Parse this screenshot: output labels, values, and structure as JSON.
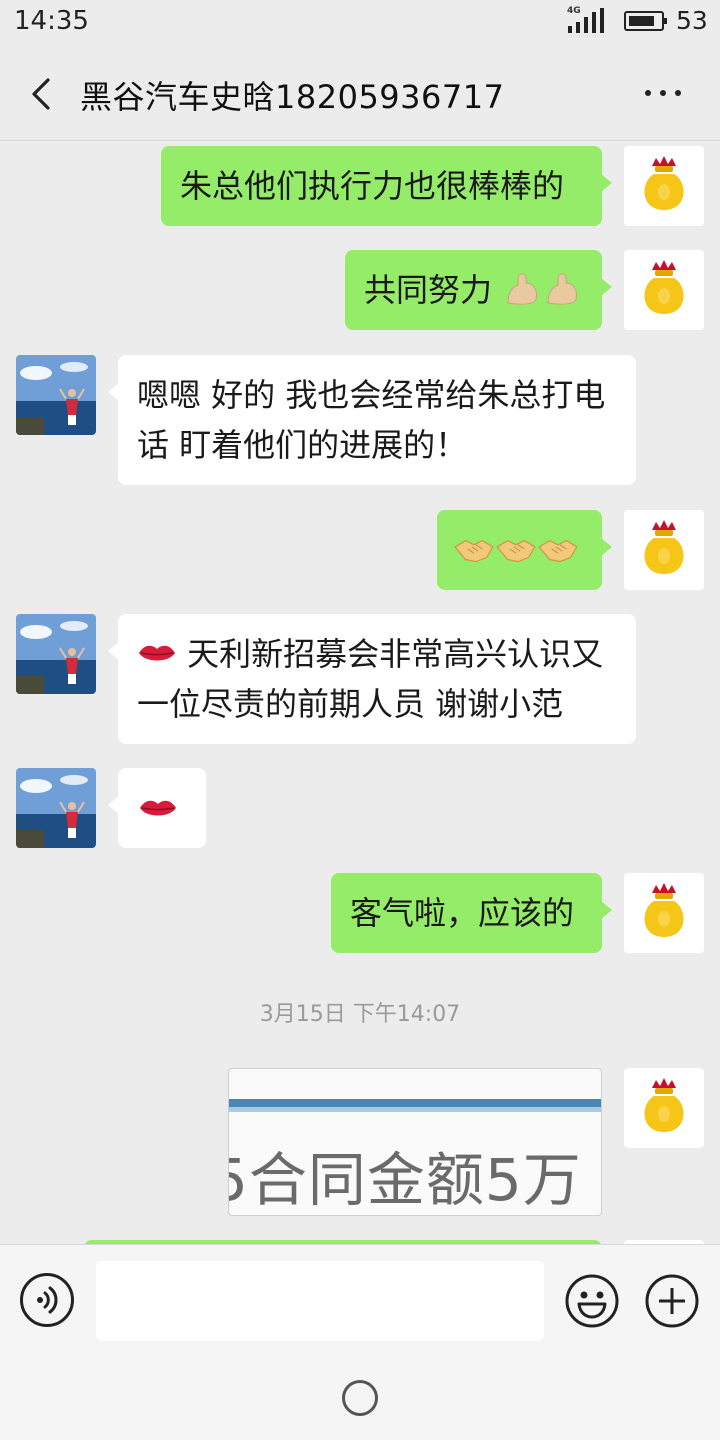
{
  "status_bar": {
    "time": "14:35",
    "network": "4G",
    "battery_level": "53"
  },
  "header": {
    "title": "黑谷汽车史晗18205936717"
  },
  "messages": [
    {
      "text": "朱总他们执行力也很棒棒的"
    },
    {
      "text": "共同努力",
      "emoji": "flexed-biceps-icon x2"
    },
    {
      "line1": "嗯嗯 好的 我也会经常给朱总打电",
      "line2": "话 盯着他们的进展的！"
    },
    {
      "emoji": "handshake-icon x3"
    },
    {
      "line1": "天利新招募会非常高兴认识又",
      "line2": "一位尽责的前期人员 谢谢小范",
      "emoji": "lips-icon"
    },
    {
      "emoji": "lips-icon"
    },
    {
      "text": "客气啦，应该的"
    }
  ],
  "timestamp": "3月15日 下午14:07",
  "image_message": {
    "visible_text": "5合同金额5万"
  },
  "colors": {
    "outgoing_bubble": "#95ec69",
    "incoming_bubble": "#ffffff",
    "background": "#ececec"
  }
}
